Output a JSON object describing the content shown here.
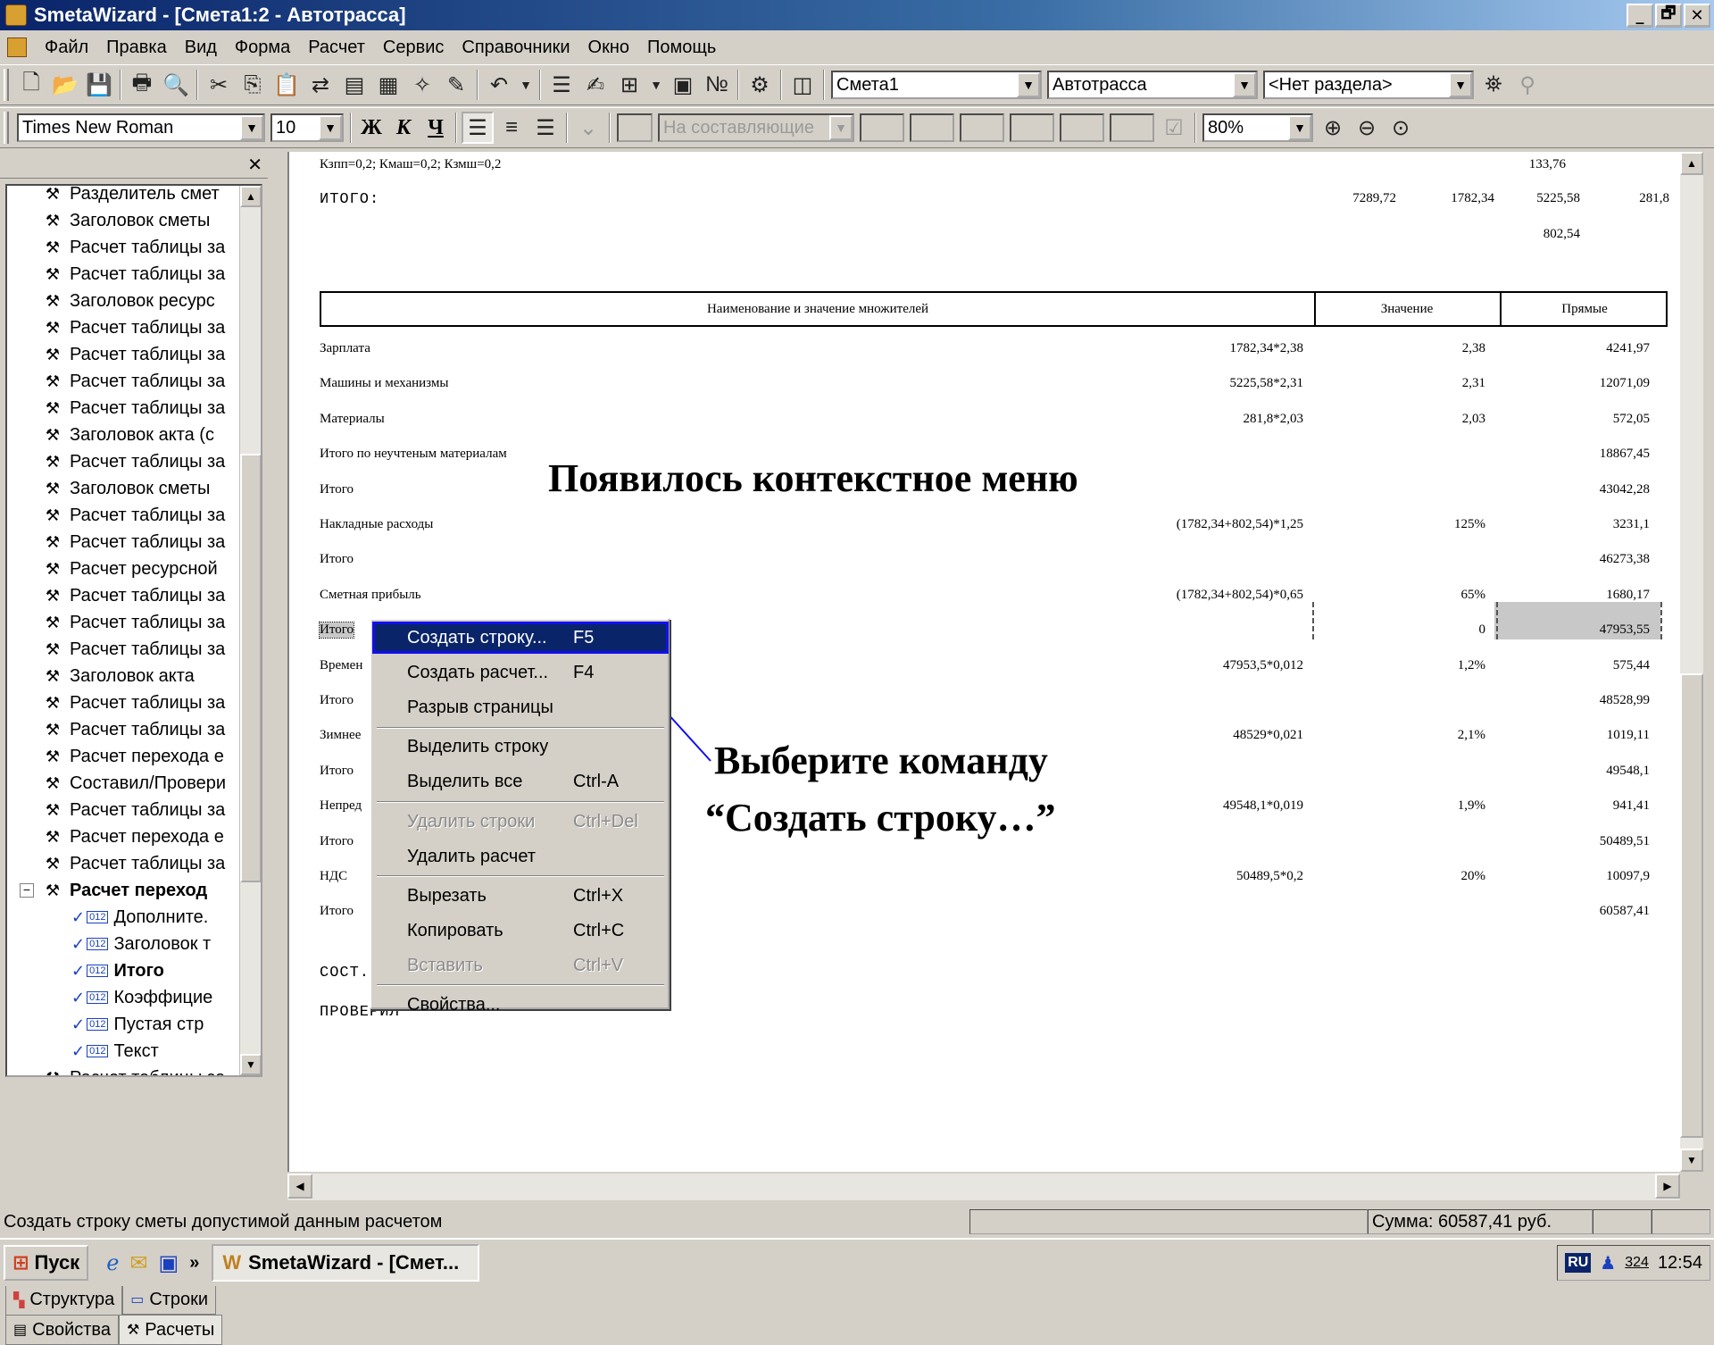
{
  "window": {
    "title": "SmetaWizard - [Смета1:2 - Автотрасса]",
    "controls": [
      "_",
      "🗗",
      "✕"
    ]
  },
  "menu": [
    "Файл",
    "Правка",
    "Вид",
    "Форма",
    "Расчет",
    "Сервис",
    "Справочники",
    "Окно",
    "Помощь"
  ],
  "toolbar": {
    "estimate_select": "Смета1",
    "object_select": "Автотрасса",
    "section_select": "<Нет раздела>"
  },
  "format_bar": {
    "font": "Times New Roman",
    "size": "10",
    "bold": "Ж",
    "italic": "К",
    "underline": "Ч",
    "components_select": "На составляющие",
    "zoom": "80%"
  },
  "tree": {
    "items": [
      "Разделитель смет",
      "Заголовок сметы",
      "Расчет таблицы за",
      "Расчет таблицы за",
      "Заголовок ресурс",
      "Расчет таблицы за",
      "Расчет таблицы за",
      "Расчет таблицы за",
      "Расчет таблицы за",
      "Заголовок акта (с",
      "Расчет таблицы за",
      "Заголовок сметы",
      "Расчет таблицы за",
      "Расчет таблицы за",
      "Расчет ресурсной",
      "Расчет таблицы за",
      "Расчет таблицы за",
      "Расчет таблицы за",
      "Заголовок акта",
      "Расчет таблицы за",
      "Расчет таблицы за",
      "Расчет перехода е",
      "Составил/Провери",
      "Расчет таблицы за",
      "Расчет перехода е",
      "Расчет таблицы за"
    ],
    "expanded_item": "Расчет переход",
    "children": [
      "Дополните.",
      "Заголовок т",
      "Итого",
      "Коэффицие",
      "Пустая стр",
      "Текст"
    ],
    "last_item": "Расчет таблицы за"
  },
  "tabs": {
    "structure": "Структура",
    "rows": "Строки",
    "properties": "Свойства",
    "calcs": "Расчеты"
  },
  "document": {
    "coef_line": "Кзпп=0,2; Кмаш=0,2; Кзмш=0,2",
    "coef_value": "133,76",
    "total_label": "ИТОГО:",
    "total_values": [
      "7289,72",
      "1782,34",
      "5225,58",
      "281,8"
    ],
    "total_extra": "802,54",
    "table_headers": [
      "Наименование и значение множителей",
      "Значение",
      "Прямые"
    ],
    "rows": [
      {
        "name": "Зарплата",
        "formula": "1782,34*2,38",
        "value": "2,38",
        "direct": "4241,97"
      },
      {
        "name": "Машины и механизмы",
        "formula": "5225,58*2,31",
        "value": "2,31",
        "direct": "12071,09"
      },
      {
        "name": "Материалы",
        "formula": "281,8*2,03",
        "value": "2,03",
        "direct": "572,05"
      },
      {
        "name": "Итого по неучтеным материалам",
        "formula": "",
        "value": "",
        "direct": "18867,45"
      },
      {
        "name": "Итого",
        "formula": "",
        "value": "",
        "direct": "43042,28"
      },
      {
        "name": "Накладные расходы",
        "formula": "(1782,34+802,54)*1,25",
        "value": "125%",
        "direct": "3231,1"
      },
      {
        "name": "Итого",
        "formula": "",
        "value": "",
        "direct": "46273,38"
      },
      {
        "name": "Сметная прибыль",
        "formula": "(1782,34+802,54)*0,65",
        "value": "65%",
        "direct": "1680,17"
      },
      {
        "name": "Итого",
        "formula": "",
        "value": "0",
        "direct": "47953,55"
      },
      {
        "name": "Времен",
        "formula": "47953,5*0,012",
        "value": "1,2%",
        "direct": "575,44"
      },
      {
        "name": "Итого",
        "formula": "",
        "value": "",
        "direct": "48528,99"
      },
      {
        "name": "Зимнее",
        "formula": "48529*0,021",
        "value": "2,1%",
        "direct": "1019,11"
      },
      {
        "name": "Итого",
        "formula": "",
        "value": "",
        "direct": "49548,1"
      },
      {
        "name": "Непред",
        "formula": "49548,1*0,019",
        "value": "1,9%",
        "direct": "941,41"
      },
      {
        "name": "Итого",
        "formula": "",
        "value": "",
        "direct": "50489,51"
      },
      {
        "name": "НДС",
        "formula": "50489,5*0,2",
        "value": "20%",
        "direct": "10097,9"
      },
      {
        "name": "Итого",
        "formula": "",
        "value": "",
        "direct": "60587,41"
      }
    ],
    "sost_label": "СОСТ.",
    "checked_label": "ПРОВЕРИЛ"
  },
  "annotations": {
    "appeared": "Появилось контекстное меню",
    "choose_line1": "Выберите команду",
    "choose_line2": "“Создать строку…”"
  },
  "context_menu": {
    "items": [
      {
        "label": "Создать строку...",
        "shortcut": "F5",
        "state": "selected"
      },
      {
        "label": "Создать расчет...",
        "shortcut": "F4",
        "state": "normal"
      },
      {
        "label": "Разрыв страницы",
        "shortcut": "",
        "state": "normal"
      },
      {
        "label": "Выделить строку",
        "shortcut": "",
        "state": "normal"
      },
      {
        "label": "Выделить все",
        "shortcut": "Ctrl-A",
        "state": "normal"
      },
      {
        "label": "Удалить строки",
        "shortcut": "Ctrl+Del",
        "state": "disabled"
      },
      {
        "label": "Удалить расчет",
        "shortcut": "",
        "state": "normal"
      },
      {
        "label": "Вырезать",
        "shortcut": "Ctrl+X",
        "state": "normal"
      },
      {
        "label": "Копировать",
        "shortcut": "Ctrl+C",
        "state": "normal"
      },
      {
        "label": "Вставить",
        "shortcut": "Ctrl+V",
        "state": "disabled"
      },
      {
        "label": "Свойства...",
        "shortcut": "",
        "state": "normal"
      }
    ]
  },
  "status": {
    "hint": "Создать строку сметы допустимой данным расчетом",
    "sum": "Сумма: 60587,41 руб."
  },
  "taskbar": {
    "start": "Пуск",
    "chevron": "»",
    "task": "SmetaWizard - [Смет...",
    "lang": "RU",
    "tray_num": "324",
    "clock": "12:54"
  }
}
